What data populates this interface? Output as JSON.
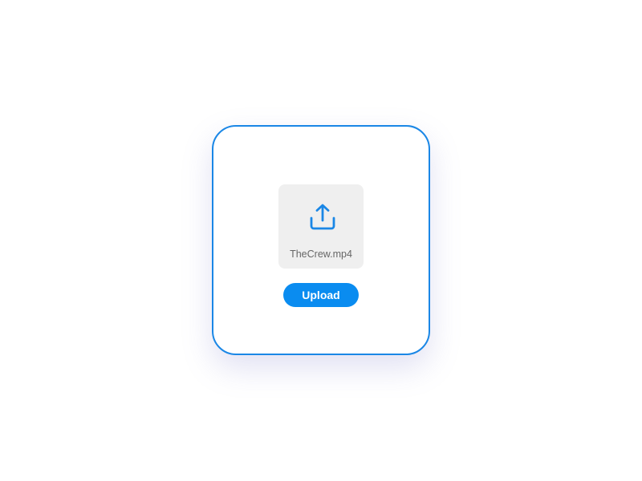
{
  "file": {
    "name": "TheCrew.mp4",
    "icon": "share-upload-icon"
  },
  "actions": {
    "upload_label": "Upload"
  },
  "colors": {
    "accent": "#0a8cf0",
    "card_border": "#1a87e6",
    "tile_background": "#efefef",
    "file_name_text": "#666666"
  }
}
